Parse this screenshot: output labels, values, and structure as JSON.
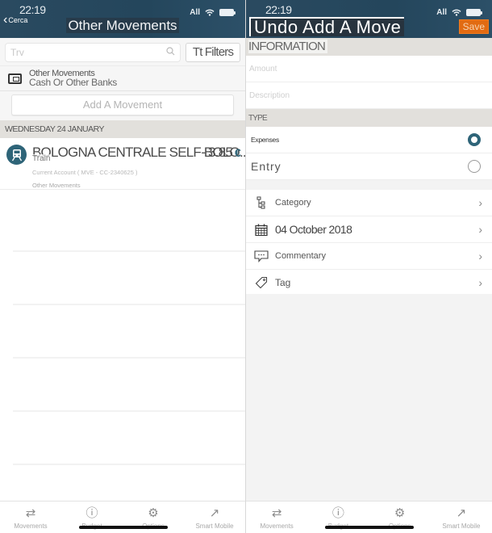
{
  "status_bar": {
    "time": "22:19",
    "carrier": "All"
  },
  "left_screen": {
    "header": {
      "back_label": "Cerca",
      "title": "Other Movements"
    },
    "search": {
      "placeholder": "Trv",
      "filters_label": "Tt Filters"
    },
    "account": {
      "name": "Other Movements",
      "subtitle": "Cash Or Other Banks"
    },
    "add_movement_label": "Add A Movement",
    "date_header": "WEDNESDAY 24 JANUARY",
    "movements": [
      {
        "title": "BOLOGNA CENTRALE SELF BOLO...",
        "category": "Train",
        "amount": "- 3.85",
        "currency": "€",
        "account": "Current Account ( MVE - CC-2340625 )",
        "group": "Other Movements",
        "icon": "train-icon"
      }
    ]
  },
  "right_screen": {
    "header": {
      "title": "Undo Add A Move",
      "save_label": "Save"
    },
    "information_header": "INFORMATION",
    "fields": {
      "amount_placeholder": "Amount",
      "description_placeholder": "Description"
    },
    "type_header": "TYPE",
    "type_options": [
      {
        "label": "Expenses",
        "selected": true
      },
      {
        "label": "Entry",
        "selected": false
      }
    ],
    "nav_items": [
      {
        "label": "Category",
        "icon": "category-tree-icon"
      },
      {
        "label": "04 October 2018",
        "icon": "calendar-icon"
      },
      {
        "label": "Commentary",
        "icon": "comment-icon"
      },
      {
        "label": "Tag",
        "icon": "tag-icon"
      }
    ]
  },
  "tabbar": {
    "items": [
      {
        "label": "Movements",
        "icon": "transfer-arrows-icon"
      },
      {
        "label": "Budget",
        "icon": "info-icon"
      },
      {
        "label": "Options",
        "icon": "gear-icon"
      },
      {
        "label": "Smart Mobile",
        "icon": "external-link-icon"
      }
    ]
  },
  "colors": {
    "accent": "#2e6478",
    "header_bg": "#24465c",
    "save_button": "#e26b12",
    "section_bg": "#e2e0dc"
  }
}
